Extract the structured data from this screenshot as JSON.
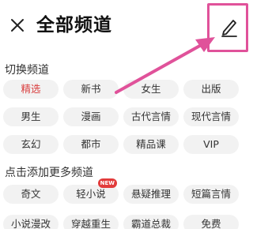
{
  "header": {
    "title": "全部频道"
  },
  "sections": {
    "switch_title": "切换频道",
    "add_title": "点击添加更多频道"
  },
  "switch_channels": [
    "精选",
    "新书",
    "女生",
    "出版",
    "男生",
    "漫画",
    "古代言情",
    "现代言情",
    "玄幻",
    "都市",
    "精品课",
    "VIP"
  ],
  "active_channel": "精选",
  "more_channels": [
    "奇文",
    "轻小说",
    "悬疑推理",
    "短篇言情",
    "小说漫改",
    "穿越重生",
    "霸道总裁",
    "免费"
  ],
  "badge": {
    "label": "NEW",
    "channel": "轻小说"
  },
  "colors": {
    "accent": "#d93d3d",
    "annotation": "#e0529a",
    "chip_bg": "#f2f2f2",
    "badge_bg": "#e23b3b"
  },
  "icons": {
    "close": "close-icon",
    "edit": "pencil-icon"
  }
}
